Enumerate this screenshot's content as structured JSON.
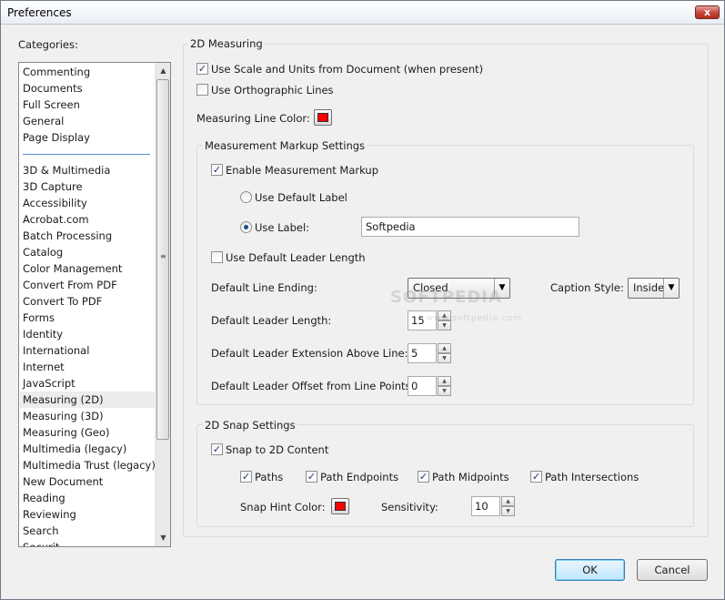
{
  "window": {
    "title": "Preferences",
    "close_glyph": "x"
  },
  "categories": {
    "label": "Categories:",
    "group1": [
      "Commenting",
      "Documents",
      "Full Screen",
      "General",
      "Page Display"
    ],
    "group2": [
      "3D & Multimedia",
      "3D Capture",
      "Accessibility",
      "Acrobat.com",
      "Batch Processing",
      "Catalog",
      "Color Management",
      "Convert From PDF",
      "Convert To PDF",
      "Forms",
      "Identity",
      "International",
      "Internet",
      "JavaScript",
      "Measuring (2D)",
      "Measuring (3D)",
      "Measuring (Geo)",
      "Multimedia (legacy)",
      "Multimedia Trust (legacy)",
      "New Document",
      "Reading",
      "Reviewing",
      "Search",
      "Securit"
    ],
    "selected": "Measuring (2D)"
  },
  "measuring": {
    "title": "2D Measuring",
    "use_scale_label": "Use Scale and Units from Document (when present)",
    "use_scale_checked": true,
    "ortho_label": "Use Orthographic Lines",
    "ortho_checked": false,
    "line_color_label": "Measuring Line Color:",
    "line_color": "#ff0000"
  },
  "markup": {
    "title": "Measurement Markup Settings",
    "enable_label": "Enable Measurement Markup",
    "enable_checked": true,
    "default_label_radio": "Use Default Label",
    "use_label_radio": "Use Label:",
    "label_value": "Softpedia",
    "default_leader_label": "Use Default Leader Length",
    "default_leader_checked": false,
    "line_ending_label": "Default Line Ending:",
    "line_ending_value": "Closed",
    "caption_style_label": "Caption Style:",
    "caption_style_value": "Inside",
    "leader_length_label": "Default Leader Length:",
    "leader_length_value": "15",
    "leader_ext_label": "Default Leader Extension Above Line:",
    "leader_ext_value": "5",
    "leader_offset_label": "Default Leader Offset from Line Points:",
    "leader_offset_value": "0"
  },
  "snap": {
    "title": "2D Snap Settings",
    "snap_label": "Snap to 2D Content",
    "snap_checked": true,
    "paths": "Paths",
    "endpoints": "Path Endpoints",
    "midpoints": "Path Midpoints",
    "intersections": "Path Intersections",
    "hint_color_label": "Snap Hint Color:",
    "hint_color": "#ff0000",
    "sensitivity_label": "Sensitivity:",
    "sensitivity_value": "10"
  },
  "buttons": {
    "ok": "OK",
    "cancel": "Cancel"
  },
  "watermark": {
    "main": "SOFTPEDIA",
    "sub": "www.softpedia.com"
  },
  "icons": {
    "check": "✓",
    "scroll_up": "▲",
    "scroll_down": "▼",
    "combo_arrow": "▼",
    "spin_up": "▲",
    "spin_down": "▼"
  }
}
